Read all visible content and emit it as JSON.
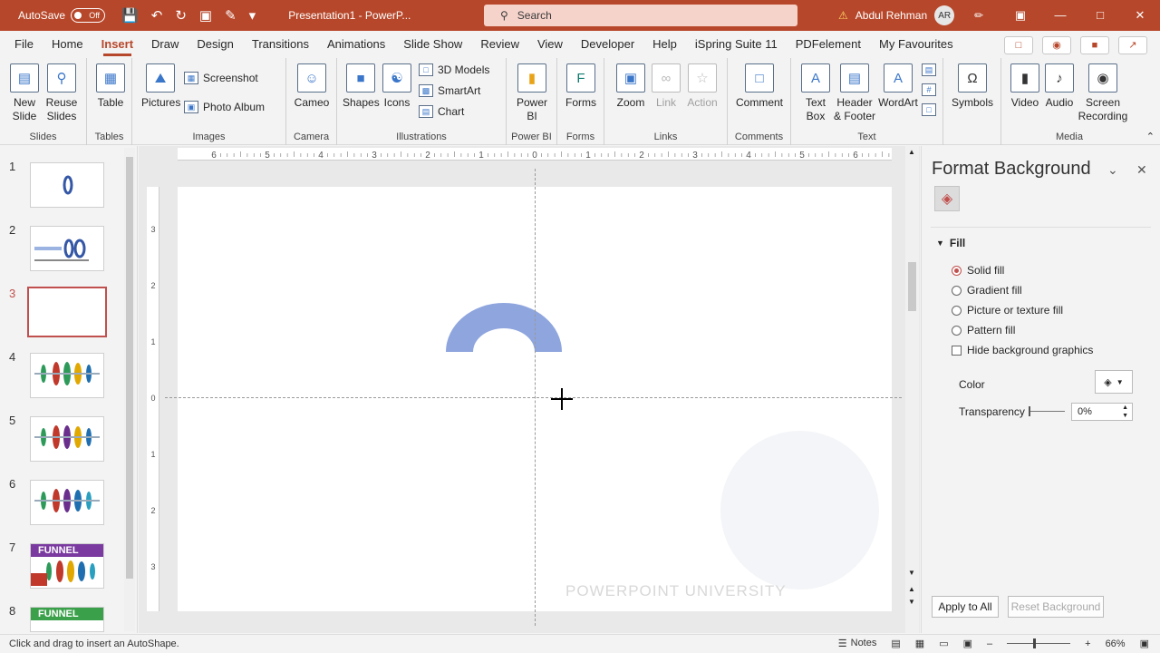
{
  "titlebar": {
    "autosave_label": "AutoSave",
    "autosave_state": "Off",
    "doc_title": "Presentation1 - PowerP...",
    "search_placeholder": "Search",
    "user_name": "Abdul Rehman",
    "user_initials": "AR"
  },
  "menu": {
    "tabs": [
      "File",
      "Home",
      "Insert",
      "Draw",
      "Design",
      "Transitions",
      "Animations",
      "Slide Show",
      "Review",
      "View",
      "Developer",
      "Help",
      "iSpring Suite 11",
      "PDFelement",
      "My Favourites"
    ],
    "active": "Insert"
  },
  "ribbon": {
    "slides": {
      "label": "Slides",
      "new_slide": "New Slide",
      "reuse_slides": "Reuse Slides"
    },
    "tables": {
      "label": "Tables",
      "table": "Table"
    },
    "images": {
      "label": "Images",
      "pictures": "Pictures",
      "screenshot": "Screenshot",
      "photo_album": "Photo Album"
    },
    "camera": {
      "label": "Camera",
      "cameo": "Cameo"
    },
    "illustrations": {
      "label": "Illustrations",
      "shapes": "Shapes",
      "icons": "Icons",
      "models": "3D Models",
      "smartart": "SmartArt",
      "chart": "Chart"
    },
    "powerbi": {
      "label": "Power BI",
      "power_bi": "Power BI"
    },
    "forms": {
      "label": "Forms",
      "forms": "Forms"
    },
    "links": {
      "label": "Links",
      "zoom": "Zoom",
      "link": "Link",
      "action": "Action"
    },
    "comments": {
      "label": "Comments",
      "comment": "Comment"
    },
    "text": {
      "label": "Text",
      "text_box": "Text Box",
      "header_footer": "Header & Footer",
      "wordart": "WordArt"
    },
    "symbols": {
      "symbols": "Symbols"
    },
    "media": {
      "label": "Media",
      "video": "Video",
      "audio": "Audio",
      "screen_recording": "Screen Recording"
    }
  },
  "slides": [
    {
      "num": "1"
    },
    {
      "num": "2"
    },
    {
      "num": "3"
    },
    {
      "num": "4"
    },
    {
      "num": "5"
    },
    {
      "num": "6"
    },
    {
      "num": "7",
      "text": "FUNNEL"
    },
    {
      "num": "8",
      "text": "FUNNEL"
    }
  ],
  "selected_slide": "3",
  "ruler": {
    "h_ticks": [
      "6",
      "5",
      "4",
      "3",
      "2",
      "1",
      "0",
      "1",
      "2",
      "3",
      "4",
      "5",
      "6"
    ],
    "v_ticks": [
      "3",
      "2",
      "1",
      "0",
      "1",
      "2",
      "3"
    ]
  },
  "slide_canvas": {
    "watermark": "POWERPOINT UNIVERSITY",
    "shape_color": "#8ea5de"
  },
  "format_panel": {
    "title": "Format Background",
    "section": "Fill",
    "options": [
      "Solid fill",
      "Gradient fill",
      "Picture or texture fill",
      "Pattern fill"
    ],
    "selected_option": "Solid fill",
    "hide_bg": "Hide background graphics",
    "color_label": "Color",
    "transparency_label": "Transparency",
    "transparency_value": "0%",
    "apply_all": "Apply to All",
    "reset": "Reset Background"
  },
  "status": {
    "hint": "Click and drag to insert an AutoShape.",
    "notes": "Notes",
    "zoom": "66%"
  },
  "colors": {
    "accent": "#b7472a",
    "selection": "#c0504d"
  }
}
